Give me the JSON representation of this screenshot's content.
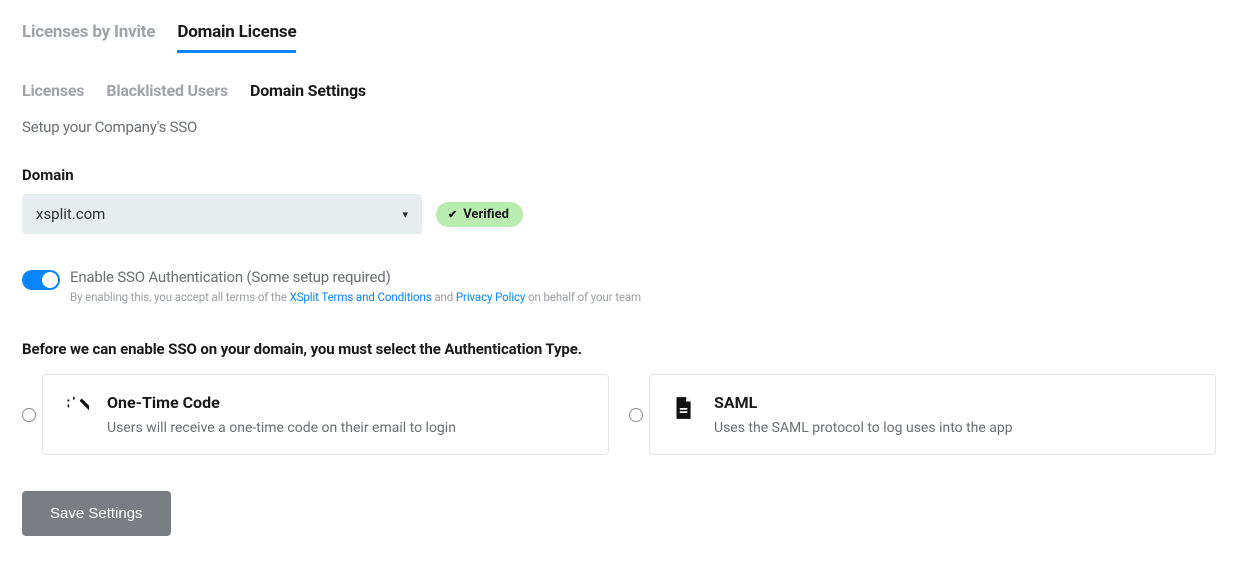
{
  "primary_tabs": [
    {
      "label": "Licenses by Invite",
      "active": false
    },
    {
      "label": "Domain License",
      "active": true
    }
  ],
  "secondary_tabs": [
    {
      "label": "Licenses",
      "active": false
    },
    {
      "label": "Blacklisted Users",
      "active": false
    },
    {
      "label": "Domain Settings",
      "active": true
    }
  ],
  "subtitle": "Setup your Company's SSO",
  "domain": {
    "field_label": "Domain",
    "selected": "xsplit.com",
    "verified_label": "Verified"
  },
  "sso_toggle": {
    "title": "Enable SSO Authentication (Some setup required)",
    "fine_prefix": "By enabling this, you accept all terms of the ",
    "terms_link": "XSplit Terms and Conditions",
    "fine_mid": " and ",
    "privacy_link": "Privacy Policy",
    "fine_suffix": " on behalf of your team"
  },
  "auth_heading": "Before we can enable SSO on your domain, you must select the Authentication Type.",
  "auth_options": [
    {
      "title": "One-Time Code",
      "desc": "Users will receive a one-time code on their email to login",
      "icon": "magic-wand"
    },
    {
      "title": "SAML",
      "desc": "Uses the SAML protocol to log uses into the app",
      "icon": "document"
    }
  ],
  "save_button": "Save Settings"
}
